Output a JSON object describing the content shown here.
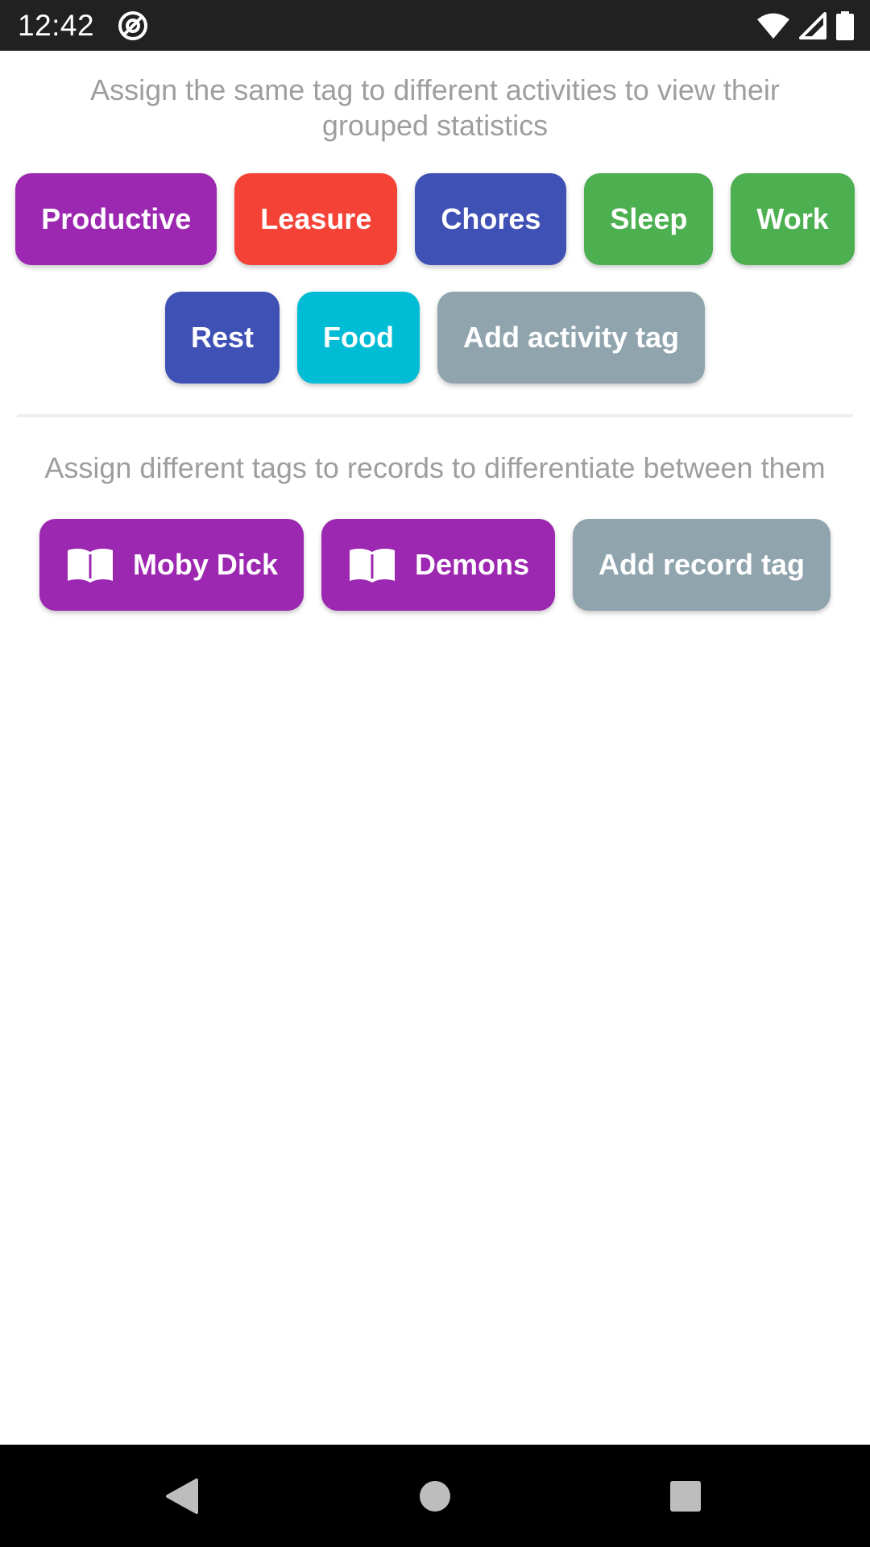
{
  "status_bar": {
    "time": "12:42",
    "icons": [
      "at-sign-icon",
      "wifi-icon",
      "signal-icon",
      "battery-icon"
    ]
  },
  "activity_section": {
    "hint": "Assign the same tag to different activities to view their grouped statistics",
    "tags": [
      {
        "label": "Productive",
        "color": "#9c27b0"
      },
      {
        "label": "Leasure",
        "color": "#f44336"
      },
      {
        "label": "Chores",
        "color": "#3f51b5"
      },
      {
        "label": "Sleep",
        "color": "#4caf50"
      },
      {
        "label": "Work",
        "color": "#4caf50"
      },
      {
        "label": "Rest",
        "color": "#3f51b5"
      },
      {
        "label": "Food",
        "color": "#00bcd4"
      }
    ],
    "add_label": "Add activity tag",
    "add_color": "#90a4ae"
  },
  "record_section": {
    "hint": "Assign different tags to records to differentiate between them",
    "tags": [
      {
        "label": "Moby Dick",
        "color": "#9c27b0",
        "icon": "book-icon"
      },
      {
        "label": "Demons",
        "color": "#9c27b0",
        "icon": "book-icon"
      }
    ],
    "add_label": "Add record tag",
    "add_color": "#90a4ae"
  },
  "nav_bar": {
    "icons": [
      "back-icon",
      "home-icon",
      "recents-icon"
    ]
  }
}
